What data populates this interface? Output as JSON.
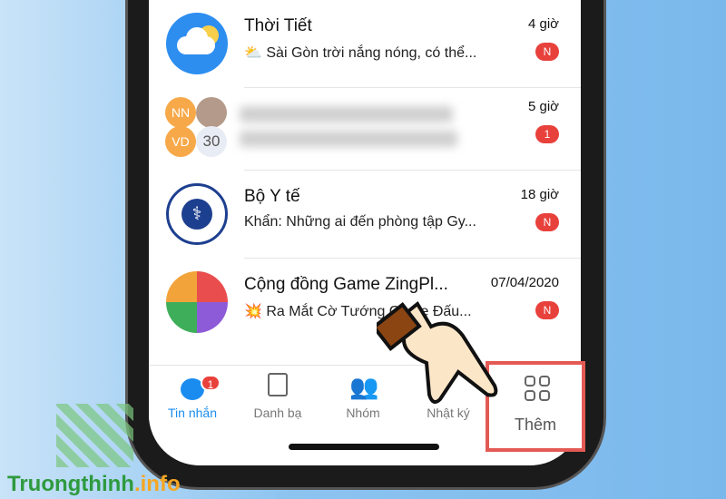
{
  "conversations": [
    {
      "title": "Thời Tiết",
      "preview": "⛅ Sài Gòn trời nắng nóng, có thể...",
      "time": "4 giờ",
      "badge": "N"
    },
    {
      "title": "",
      "preview": "",
      "time": "5 giờ",
      "badge": "1",
      "members": [
        "NN",
        "VD"
      ],
      "member_count": "30"
    },
    {
      "title": "Bộ Y tế",
      "preview": "Khẩn: Những ai đến phòng tập Gy...",
      "time": "18 giờ",
      "badge": "N"
    },
    {
      "title": "Cộng đồng Game ZingPl...",
      "preview": "💥 Ra Mắt Cờ Tướng Game Đấu...",
      "time": "07/04/2020",
      "badge": "N"
    }
  ],
  "tabs": [
    {
      "label": "Tin nhắn",
      "badge": "1",
      "active": true,
      "icon": "chat-icon"
    },
    {
      "label": "Danh bạ",
      "icon": "contacts-icon"
    },
    {
      "label": "Nhóm",
      "icon": "group-icon"
    },
    {
      "label": "Nhật ký",
      "icon": "timeline-icon"
    },
    {
      "label": "Thêm",
      "icon": "grid-icon",
      "highlighted": true
    }
  ],
  "colors": {
    "accent": "#1a8cf0",
    "badge": "#e8413c",
    "highlight": "#e35a55"
  },
  "watermark": {
    "main": "Truongthinh",
    "suffix": ".info"
  }
}
